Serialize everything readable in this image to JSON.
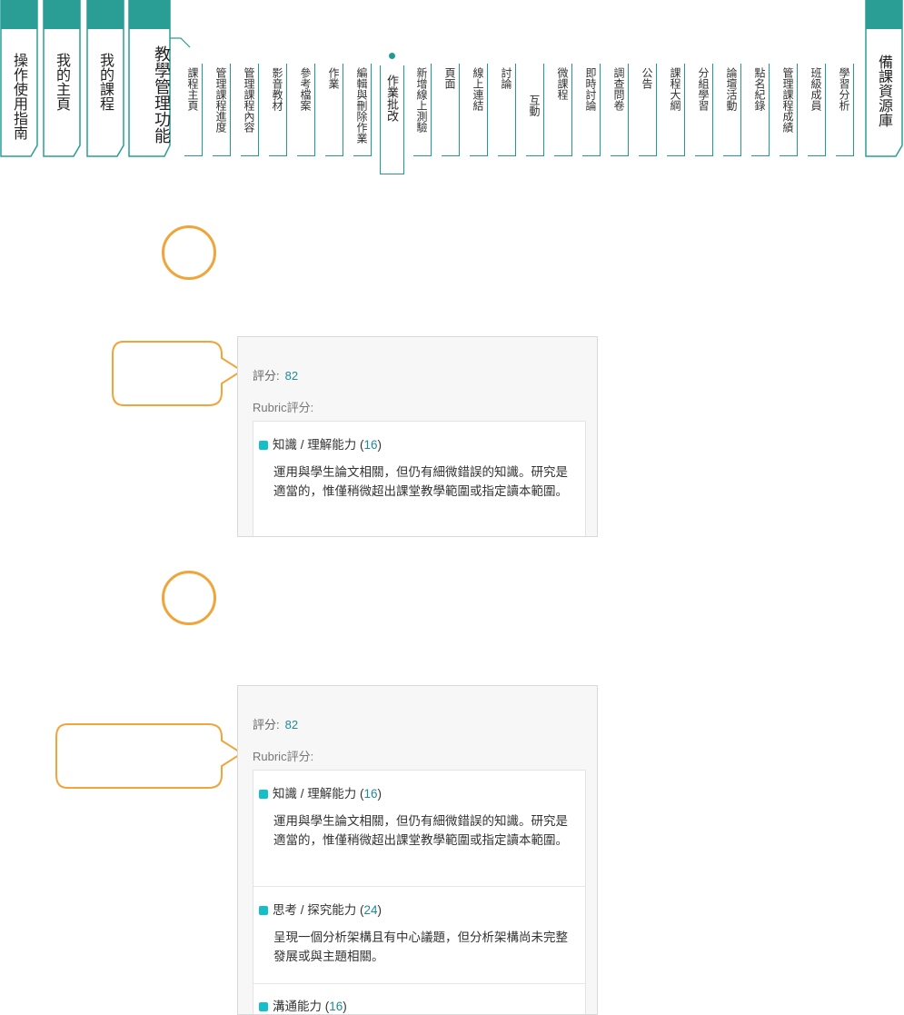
{
  "nav": {
    "main_tabs": [
      {
        "label": "操作使用指南"
      },
      {
        "label": "我的主頁"
      },
      {
        "label": "我的課程"
      },
      {
        "label": "教學管理功能"
      }
    ],
    "sub_items": [
      {
        "label": "課程主頁"
      },
      {
        "label": "管理課程進度"
      },
      {
        "label": "管理課程內容"
      },
      {
        "label": "影音教材"
      },
      {
        "label": "參考檔案"
      },
      {
        "label": "作業"
      },
      {
        "label": "編輯與刪除作業"
      },
      {
        "label": "新增線上測驗"
      },
      {
        "label": "頁面"
      },
      {
        "label": "線上連結"
      },
      {
        "label": "討論"
      },
      {
        "label": "互動"
      },
      {
        "label": "微課程"
      },
      {
        "label": "即時討論"
      },
      {
        "label": "調查問卷"
      },
      {
        "label": "公告"
      },
      {
        "label": "課程大綱"
      },
      {
        "label": "分組學習"
      },
      {
        "label": "論壇活動"
      },
      {
        "label": "點名紀錄"
      },
      {
        "label": "管理課程成績"
      },
      {
        "label": "班級成員"
      },
      {
        "label": "學習分析"
      }
    ],
    "active_item": {
      "label": "作業批改"
    },
    "resource_tab": {
      "label": "備課資源庫"
    }
  },
  "panel1": {
    "score_label": "評分:",
    "score_value": "82",
    "rubric_label": "Rubric評分:",
    "criteria": [
      {
        "name": "知識 / 理解能力 (",
        "points": "16",
        "close": ")",
        "desc": "運用與學生論文相關，但仍有細微錯誤的知識。研究是適當的，惟僅稍微超出課堂教學範圍或指定讀本範圍。"
      }
    ]
  },
  "panel2": {
    "score_label": "評分:",
    "score_value": "82",
    "rubric_label": "Rubric評分:",
    "criteria": [
      {
        "name": "知識 / 理解能力 (",
        "points": "16",
        "close": ")",
        "desc": "運用與學生論文相關，但仍有細微錯誤的知識。研究是適當的，惟僅稍微超出課堂教學範圍或指定讀本範圍。"
      },
      {
        "name": "思考 / 探究能力 (",
        "points": "24",
        "close": ")",
        "desc": "呈現一個分析架構且有中心議題，但分析架構尚未完整發展或與主題相關。"
      },
      {
        "name": "溝通能力 (",
        "points": "16",
        "close": ")",
        "desc": ""
      }
    ]
  },
  "colors": {
    "teal": "#2a9d95",
    "teal_line": "#1f9a98",
    "marker_orange": "#f0a53a",
    "criterion_square": "#13bfc8",
    "score_value": "#1f8a9a"
  },
  "icons": {
    "marker": "ring-marker",
    "callout": "speech-bubble",
    "criterion": "teal-square"
  }
}
